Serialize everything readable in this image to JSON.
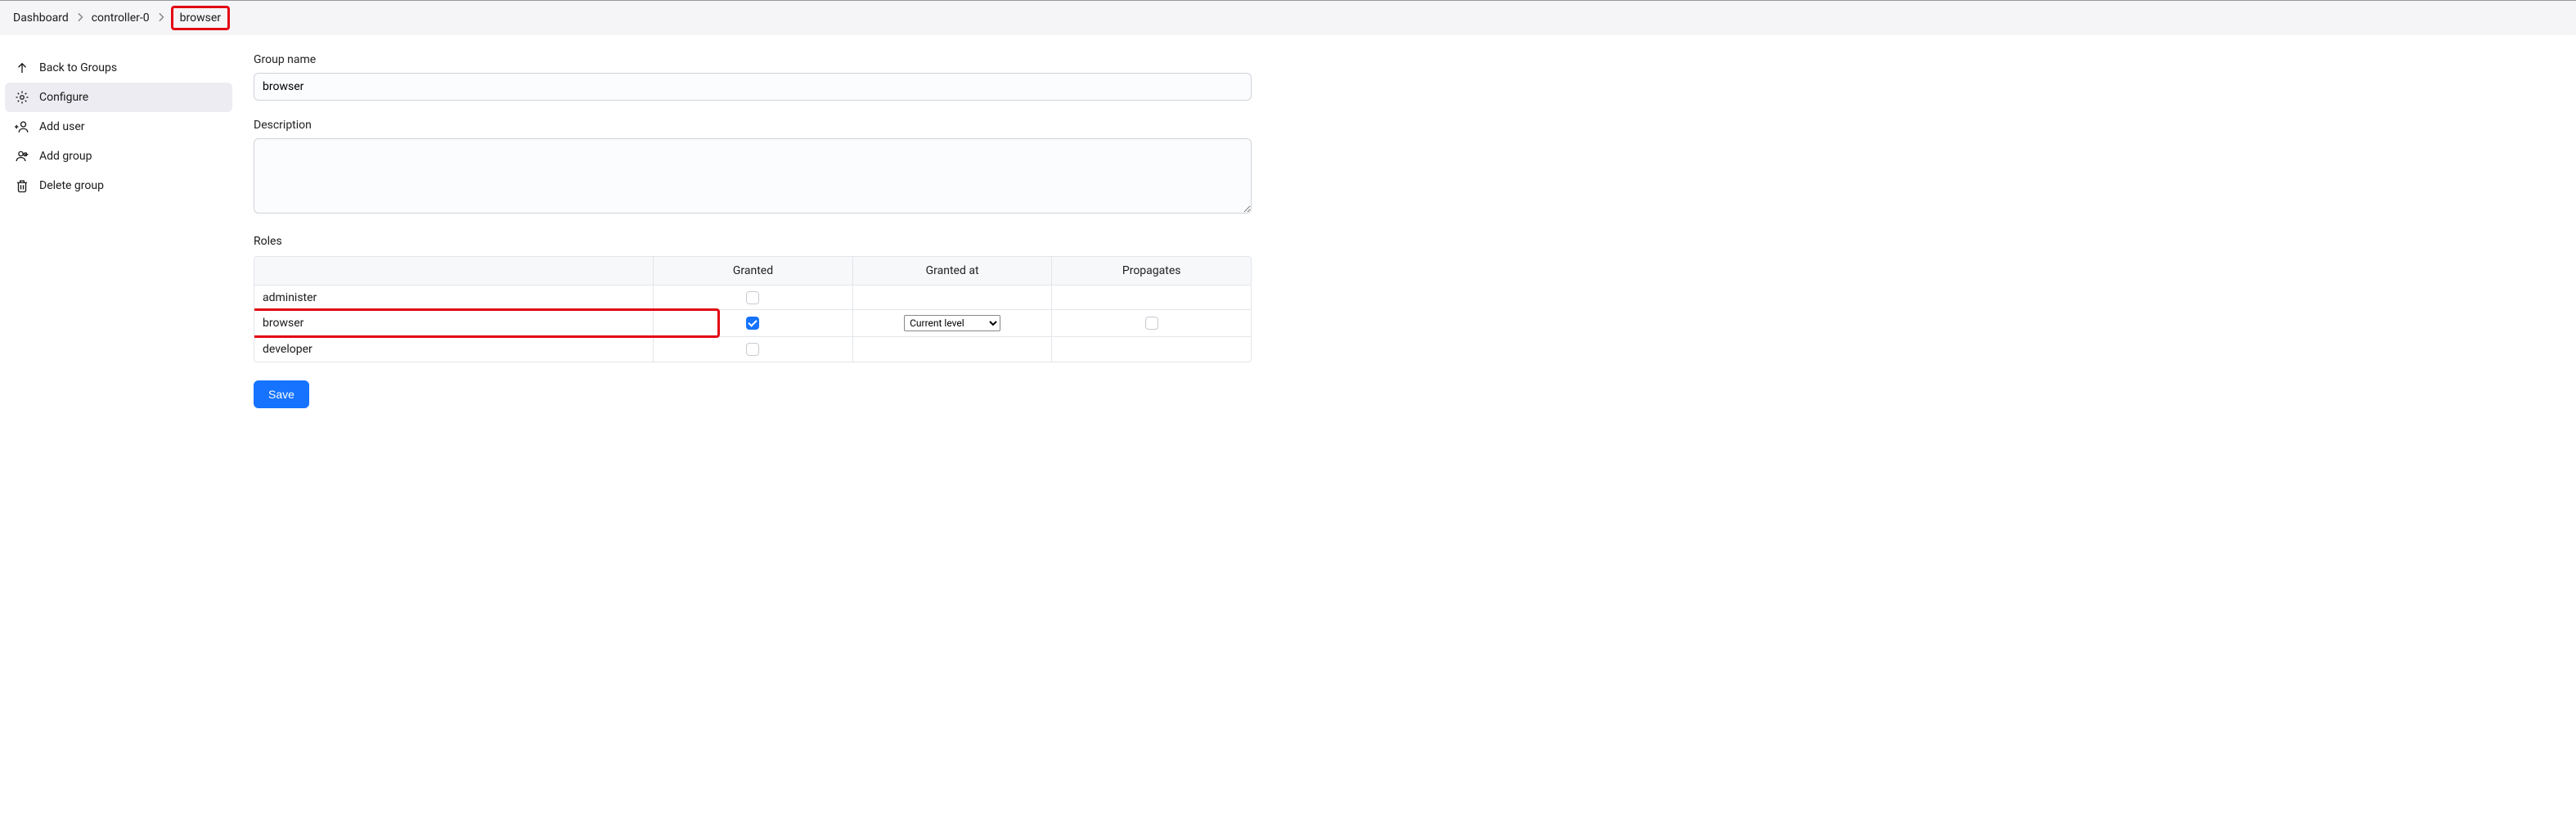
{
  "breadcrumb": {
    "items": [
      "Dashboard",
      "controller-0",
      "browser"
    ],
    "highlight_index": 2
  },
  "sidebar": {
    "items": [
      {
        "label": "Back to Groups",
        "icon": "arrow-up",
        "active": false
      },
      {
        "label": "Configure",
        "icon": "gear",
        "active": true
      },
      {
        "label": "Add user",
        "icon": "add-user",
        "active": false
      },
      {
        "label": "Add group",
        "icon": "add-group",
        "active": false
      },
      {
        "label": "Delete group",
        "icon": "trash",
        "active": false
      }
    ]
  },
  "form": {
    "group_name_label": "Group name",
    "group_name_value": "browser",
    "description_label": "Description",
    "description_value": "",
    "roles_label": "Roles"
  },
  "roles_table": {
    "headers": [
      "",
      "Granted",
      "Granted at",
      "Propagates"
    ],
    "rows": [
      {
        "name": "administer",
        "granted": false,
        "granted_at": null,
        "propagates": null,
        "highlight": false
      },
      {
        "name": "browser",
        "granted": true,
        "granted_at": "Current level",
        "propagates": false,
        "highlight": true
      },
      {
        "name": "developer",
        "granted": false,
        "granted_at": null,
        "propagates": null,
        "highlight": false
      }
    ],
    "granted_at_options": [
      "Current level"
    ]
  },
  "buttons": {
    "save": "Save"
  }
}
